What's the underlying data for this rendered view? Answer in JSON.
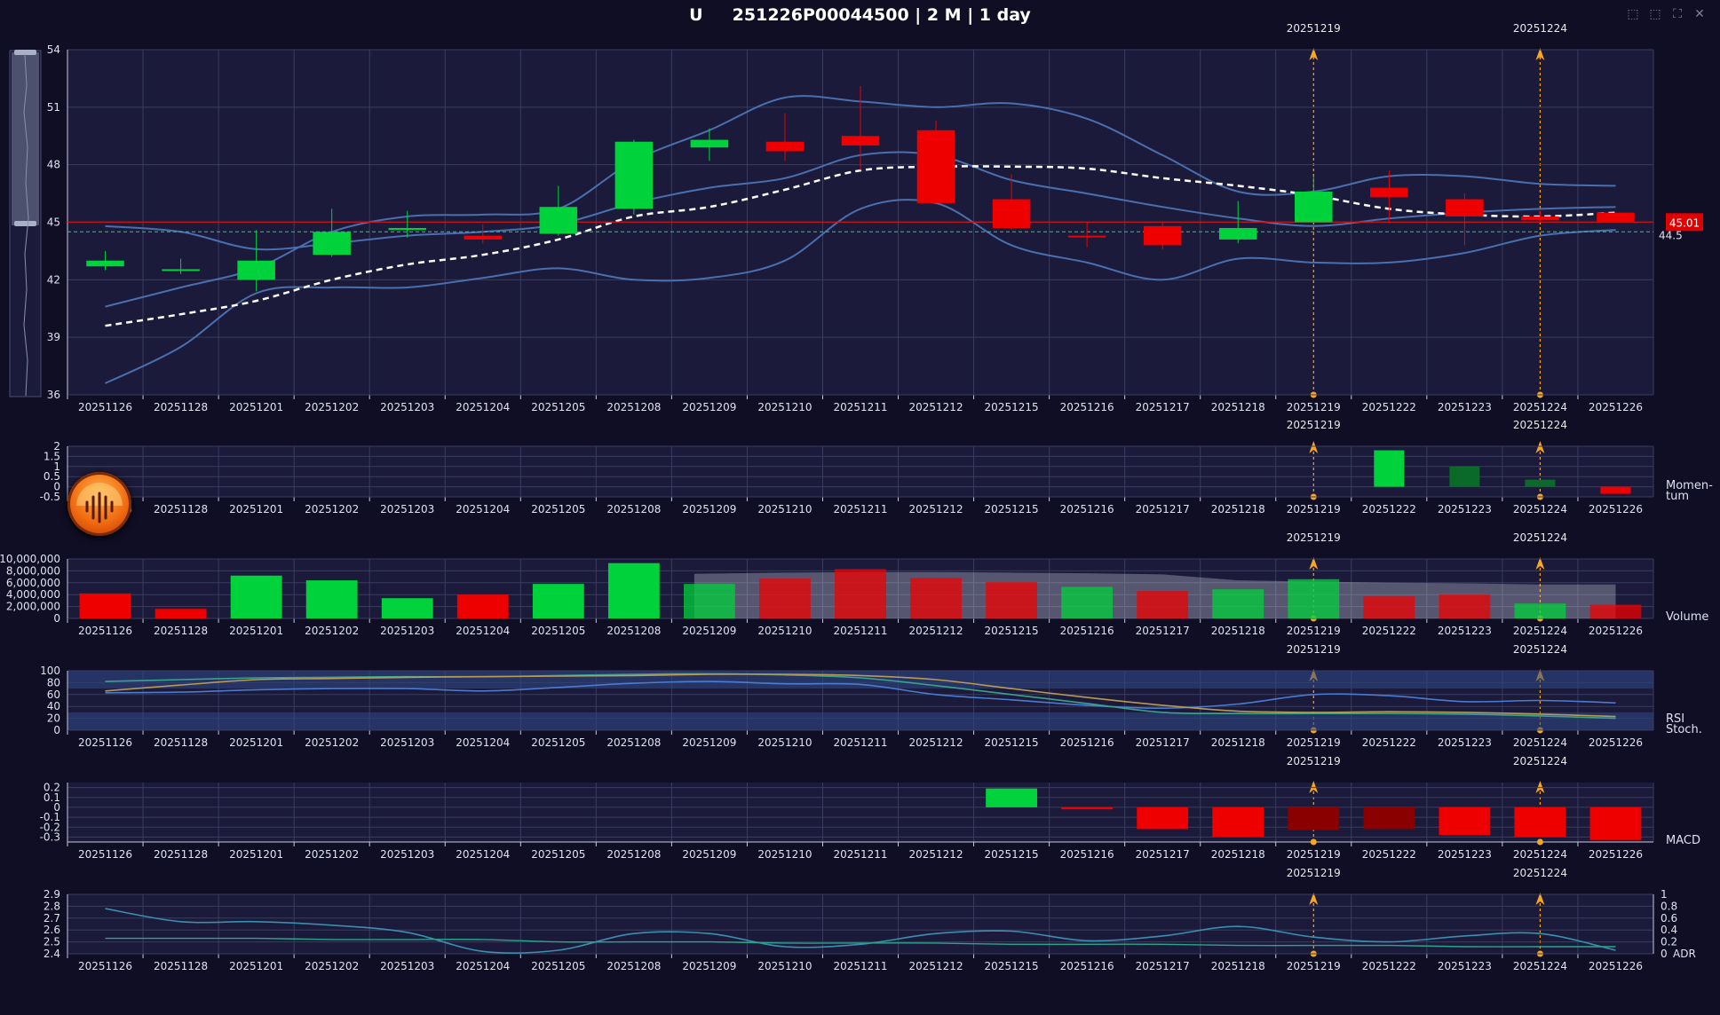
{
  "title": "U     251226P00044500 | 2 M | 1 day",
  "toolbar": {
    "icons": [
      "zoom-select-icon",
      "zoom-back-icon",
      "reset-zoom-icon",
      "close-icon"
    ],
    "glyphs": [
      "⬚",
      "⬚",
      "⛶",
      "✕"
    ]
  },
  "colors": {
    "bg": "#0f0e24",
    "plot_bg": "#1b1a3a",
    "up": "#00d23c",
    "down": "#ef0000",
    "band": "#4a6fae",
    "ma": "#ffffff",
    "grid": "#3a3d5e",
    "marker": "#f5a623"
  },
  "markers": [
    "20251219",
    "20251224"
  ],
  "chart_data": [
    {
      "panel": "price",
      "type": "candlestick",
      "categories": [
        "20251126",
        "20251128",
        "20251201",
        "20251202",
        "20251203",
        "20251204",
        "20251205",
        "20251208",
        "20251209",
        "20251210",
        "20251211",
        "20251212",
        "20251215",
        "20251216",
        "20251217",
        "20251218",
        "20251219",
        "20251222",
        "20251223",
        "20251224",
        "20251226"
      ],
      "ohlc": [
        [
          42.7,
          43.5,
          42.5,
          43.0
        ],
        [
          42.5,
          43.1,
          42.3,
          42.55
        ],
        [
          42.0,
          44.6,
          41.4,
          43.0
        ],
        [
          43.3,
          45.7,
          43.2,
          44.5
        ],
        [
          44.6,
          45.6,
          44.2,
          44.7
        ],
        [
          44.3,
          44.9,
          43.9,
          44.1
        ],
        [
          44.4,
          46.9,
          44.3,
          45.8
        ],
        [
          45.7,
          49.3,
          45.4,
          49.2
        ],
        [
          48.9,
          49.9,
          48.2,
          49.3
        ],
        [
          49.2,
          50.7,
          48.2,
          48.7
        ],
        [
          49.5,
          52.1,
          47.7,
          49.0
        ],
        [
          49.8,
          50.3,
          46.0,
          46.0
        ],
        [
          46.2,
          47.5,
          44.6,
          44.7
        ],
        [
          44.3,
          45.0,
          43.7,
          44.25
        ],
        [
          44.8,
          45.0,
          43.6,
          43.8
        ],
        [
          44.1,
          46.1,
          43.9,
          44.7
        ],
        [
          45.0,
          47.4,
          45.0,
          46.6
        ],
        [
          46.8,
          47.7,
          45.0,
          46.3
        ],
        [
          46.2,
          46.5,
          43.8,
          45.3
        ],
        [
          45.3,
          45.6,
          45.0,
          45.1
        ],
        [
          45.5,
          45.5,
          45.01,
          45.01
        ]
      ],
      "ylim": [
        36,
        54
      ],
      "yticks": [
        36,
        39,
        42,
        45,
        48,
        51,
        54
      ],
      "ma": [
        39.6,
        40.2,
        40.9,
        42.0,
        42.8,
        43.3,
        44.1,
        45.3,
        45.8,
        46.7,
        47.7,
        47.9,
        47.9,
        47.8,
        47.3,
        46.9,
        46.4,
        45.7,
        45.4,
        45.3,
        45.5
      ],
      "upper_band": [
        40.6,
        41.6,
        42.6,
        44.5,
        45.3,
        45.4,
        45.7,
        48.2,
        49.8,
        51.5,
        51.3,
        51.0,
        51.2,
        50.4,
        48.5,
        46.6,
        46.6,
        47.4,
        47.4,
        47.0,
        46.9
      ],
      "middle_band": [
        44.8,
        44.5,
        43.6,
        43.9,
        44.3,
        44.5,
        44.9,
        46.0,
        46.8,
        47.3,
        48.5,
        48.5,
        47.2,
        46.5,
        45.8,
        45.2,
        44.8,
        45.2,
        45.5,
        45.7,
        45.8
      ],
      "lower_band": [
        36.6,
        38.5,
        41.3,
        41.6,
        41.6,
        42.1,
        42.6,
        42.0,
        42.1,
        43.0,
        45.7,
        46.0,
        43.8,
        42.9,
        42.0,
        43.1,
        42.9,
        42.9,
        43.4,
        44.3,
        44.6
      ],
      "last_price": "45.01",
      "last_price_value": 45.01,
      "ref_line_label": "44.5",
      "ref_line_value": 44.5
    },
    {
      "panel": "momentum",
      "type": "bar",
      "name": "Momen-\ntum",
      "yticks": [
        "2",
        "1.5",
        "1",
        "0.5",
        "0",
        "-0.5"
      ],
      "ylim": [
        -0.5,
        2
      ],
      "values": [
        null,
        null,
        null,
        null,
        null,
        null,
        null,
        null,
        null,
        null,
        null,
        null,
        null,
        null,
        null,
        null,
        null,
        1.8,
        1.0,
        0.35,
        -0.35
      ],
      "colors": [
        null,
        null,
        null,
        null,
        null,
        null,
        null,
        null,
        null,
        null,
        null,
        null,
        null,
        null,
        null,
        null,
        null,
        "#00d23c",
        "#0a6a2a",
        "#0a6a2a",
        "#ef0000"
      ]
    },
    {
      "panel": "volume",
      "type": "bar",
      "name": "Volume",
      "yticks": [
        "10,000,000",
        "8,000,000",
        "6,000,000",
        "4,000,000",
        "2,000,000",
        "0"
      ],
      "ylim": [
        0,
        10000000
      ],
      "values": [
        4200000,
        1600000,
        7200000,
        6400000,
        3400000,
        4000000,
        5800000,
        9300000,
        5800000,
        6700000,
        8300000,
        6800000,
        6100000,
        5300000,
        4600000,
        4900000,
        6600000,
        3700000,
        4000000,
        2500000,
        2300000
      ],
      "up": [
        false,
        false,
        true,
        true,
        true,
        false,
        true,
        true,
        true,
        false,
        false,
        false,
        false,
        true,
        false,
        true,
        true,
        false,
        false,
        true,
        false
      ],
      "avg_volume": [
        null,
        null,
        null,
        null,
        null,
        null,
        null,
        null,
        7500000,
        7700000,
        7800000,
        7800000,
        7700000,
        7600000,
        7400000,
        6400000,
        6200000,
        6000000,
        5900000,
        5700000,
        5700000
      ]
    },
    {
      "panel": "rsi",
      "type": "line",
      "name": "RSI\nStoch.",
      "yticks": [
        "100",
        "80",
        "60",
        "40",
        "20",
        "0"
      ],
      "ylim": [
        0,
        100
      ],
      "rsi": [
        63,
        64,
        68,
        70,
        70,
        66,
        72,
        79,
        82,
        78,
        77,
        60,
        51,
        42,
        37,
        44,
        60,
        58,
        48,
        50,
        46
      ],
      "stoch_k": [
        82,
        85,
        88,
        89,
        90,
        90,
        92,
        94,
        95,
        93,
        88,
        75,
        60,
        45,
        30,
        28,
        28,
        28,
        27,
        24,
        20
      ],
      "stoch_d": [
        66,
        76,
        85,
        87,
        89,
        90,
        91,
        92,
        94,
        94,
        92,
        85,
        70,
        55,
        42,
        32,
        30,
        31,
        30,
        27,
        23
      ]
    },
    {
      "panel": "macd",
      "type": "bar",
      "name": "MACD",
      "yticks": [
        "0.2",
        "0.1",
        "0",
        "-0.1",
        "-0.2",
        "-0.3"
      ],
      "ylim": [
        -0.35,
        0.25
      ],
      "values": [
        null,
        null,
        null,
        null,
        null,
        null,
        null,
        null,
        null,
        null,
        null,
        null,
        0.19,
        -0.02,
        -0.22,
        -0.3,
        -0.23,
        -0.22,
        -0.28,
        -0.3,
        -0.33
      ],
      "colors": [
        null,
        null,
        null,
        null,
        null,
        null,
        null,
        null,
        null,
        null,
        null,
        null,
        "#00d23c",
        "#ef0000",
        "#ef0000",
        "#ef0000",
        "#8a0000",
        "#8a0000",
        "#ef0000",
        "#ef0000",
        "#ef0000"
      ]
    },
    {
      "panel": "adr",
      "type": "line",
      "name": "ADR",
      "yticks": [
        "2.9",
        "2.8",
        "2.7",
        "2.6",
        "2.5",
        "2.4"
      ],
      "ylim": [
        2.4,
        2.9
      ],
      "right_yticks": [
        "1",
        "0.8",
        "0.6",
        "0.4",
        "0.2",
        "0"
      ],
      "adr": [
        2.78,
        2.67,
        2.67,
        2.64,
        2.58,
        2.42,
        2.43,
        2.57,
        2.57,
        2.46,
        2.48,
        2.57,
        2.59,
        2.51,
        2.55,
        2.63,
        2.54,
        2.5,
        2.55,
        2.57,
        2.43
      ],
      "adr_avg": [
        2.53,
        2.53,
        2.53,
        2.52,
        2.52,
        2.52,
        2.5,
        2.5,
        2.5,
        2.49,
        2.49,
        2.49,
        2.48,
        2.48,
        2.48,
        2.47,
        2.47,
        2.47,
        2.46,
        2.46,
        2.46
      ]
    }
  ]
}
